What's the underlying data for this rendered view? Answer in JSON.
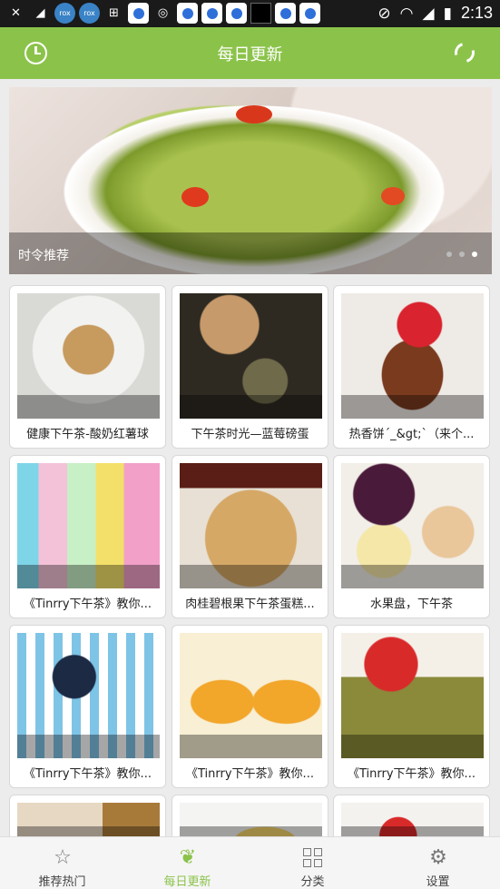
{
  "status_bar": {
    "left_icons": [
      "mute-icon",
      "signal-off-icon",
      "app-icon",
      "app-icon",
      "grid-app-icon",
      "baidu-icon",
      "wechat-icon",
      "qq-icon",
      "baidu-icon",
      "baidu-icon",
      "black-app-icon",
      "baidu-icon",
      "qq-icon"
    ],
    "time": "2:13"
  },
  "app_bar": {
    "title": "每日更新",
    "left_icon": "clock-icon",
    "right_icon": "refresh-icon"
  },
  "banner": {
    "caption": "时令推荐",
    "page_count": 3,
    "active_page": 3
  },
  "grid": {
    "items": [
      {
        "label": "健康下午茶-酸奶红薯球"
      },
      {
        "label": "下午茶时光—蓝莓磅蛋"
      },
      {
        "label": "热香饼´_&gt;`（来个..."
      },
      {
        "label": "《Tinrry下午茶》教你..."
      },
      {
        "label": "肉桂碧根果下午茶蛋糕..."
      },
      {
        "label": "水果盘，下午茶"
      },
      {
        "label": "《Tinrry下午茶》教你..."
      },
      {
        "label": "《Tinrry下午茶》教你..."
      },
      {
        "label": "《Tinrry下午茶》教你..."
      }
    ]
  },
  "bottom_nav": {
    "items": [
      {
        "label": "推荐热门",
        "icon": "star-icon",
        "active": false
      },
      {
        "label": "每日更新",
        "icon": "leaf-icon",
        "active": true
      },
      {
        "label": "分类",
        "icon": "grid-icon",
        "active": false
      },
      {
        "label": "设置",
        "icon": "gear-icon",
        "active": false
      }
    ]
  },
  "colors": {
    "accent": "#8bc34a",
    "status_bar": "#1a1a1a"
  }
}
